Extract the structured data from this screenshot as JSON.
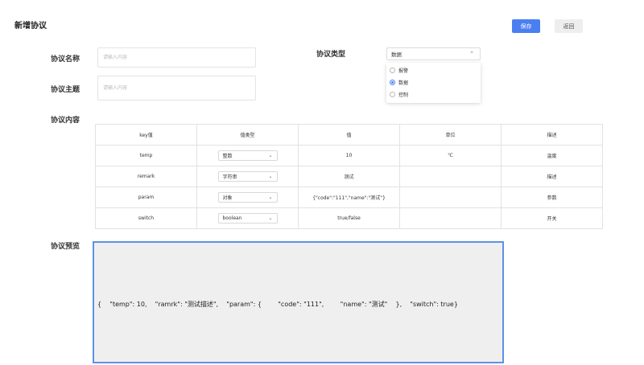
{
  "page": {
    "title": "新增协议"
  },
  "actions": {
    "save_label": "保存",
    "back_label": "返回"
  },
  "form": {
    "name_label": "协议名称",
    "name_placeholder": "请输入内容",
    "topic_label": "协议主题",
    "topic_placeholder": "请输入内容",
    "type_label": "协议类型",
    "type_selected": "数据",
    "type_options": [
      {
        "label": "报警",
        "checked": false
      },
      {
        "label": "数据",
        "checked": true
      },
      {
        "label": "控制",
        "checked": false
      }
    ],
    "content_label": "协议内容",
    "preview_label": "协议预览"
  },
  "table": {
    "headers": [
      "key值",
      "值类型",
      "值",
      "单位",
      "描述"
    ],
    "rows": [
      {
        "key": "temp",
        "type": "整数",
        "value": "10",
        "unit": "℃",
        "desc": "温度"
      },
      {
        "key": "remark",
        "type": "字符串",
        "value": "测试",
        "unit": "",
        "desc": "描述"
      },
      {
        "key": "param",
        "type": "对象",
        "value": "{\"code\":\"111\",\"name\":\"测试\"}",
        "unit": "",
        "desc": "参数"
      },
      {
        "key": "switch",
        "type": "boolean",
        "value": "true/false",
        "unit": "",
        "desc": "开关"
      }
    ]
  },
  "preview": {
    "text": "{    \"temp\": 10,    \"ramrk\": \"测试描述\",    \"param\": {        \"code\": \"111\",        \"name\": \"测试\"    },    \"switch\": true}"
  },
  "colors": {
    "primary": "#4a7ff2",
    "preview_border": "#5b93e6",
    "preview_bg": "#efefef"
  }
}
